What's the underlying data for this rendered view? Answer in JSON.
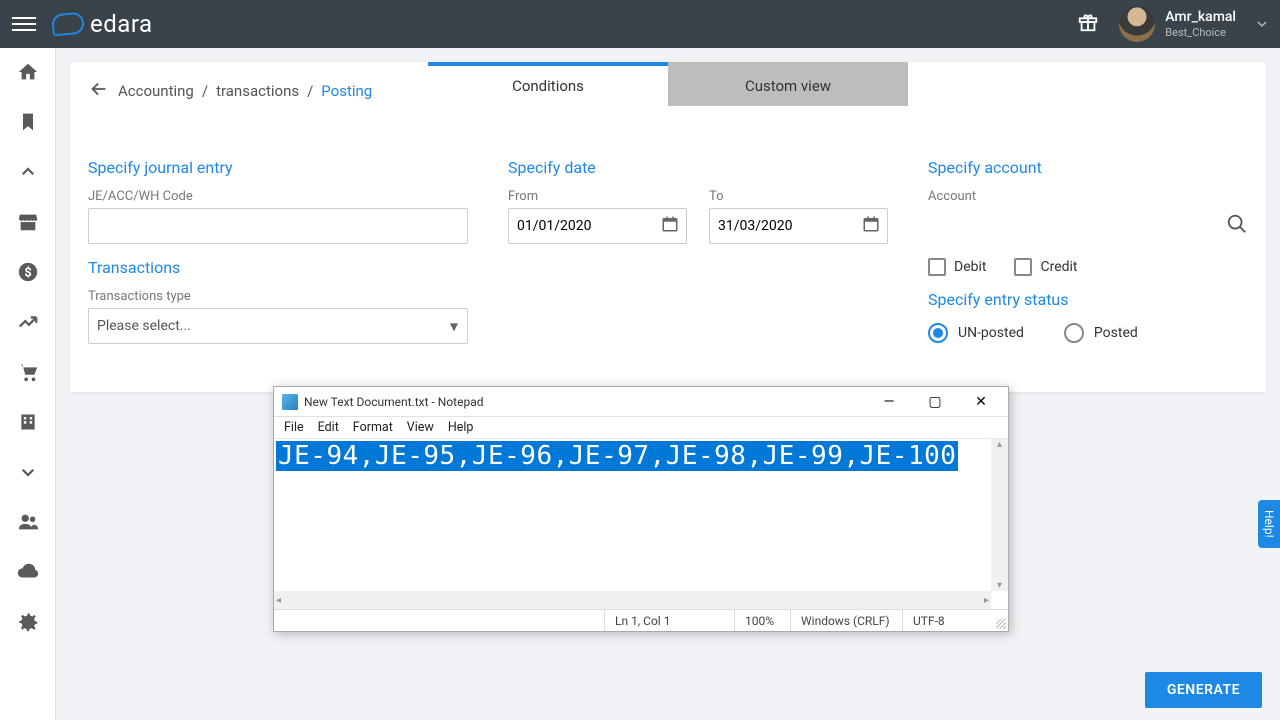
{
  "app": {
    "logo_text": "edara"
  },
  "user": {
    "name": "Amr_kamal",
    "sub": "Best_Choice"
  },
  "breadcrumb": {
    "seg1": "Accounting",
    "seg2": "transactions",
    "seg3": "Posting"
  },
  "tabs": {
    "conditions": "Conditions",
    "custom": "Custom view"
  },
  "journal": {
    "title": "Specify journal entry",
    "label": "JE/ACC/WH Code",
    "value": ""
  },
  "transactions": {
    "title": "Transactions",
    "label": "Transactions type",
    "placeholder": "Please select..."
  },
  "date": {
    "title": "Specify date",
    "from_label": "From",
    "to_label": "To",
    "from": "01/01/2020",
    "to": "31/03/2020"
  },
  "account": {
    "title": "Specify account",
    "label": "Account",
    "debit": "Debit",
    "credit": "Credit"
  },
  "status": {
    "title": "Specify entry status",
    "unposted": "UN-posted",
    "posted": "Posted"
  },
  "buttons": {
    "generate": "GENERATE"
  },
  "help": "Help!",
  "notepad": {
    "title": "New Text Document.txt - Notepad",
    "menu": {
      "file": "File",
      "edit": "Edit",
      "format": "Format",
      "view": "View",
      "help": "Help"
    },
    "text": "JE-94,JE-95,JE-96,JE-97,JE-98,JE-99,JE-100",
    "status": {
      "pos": "Ln 1, Col 1",
      "zoom": "100%",
      "eol": "Windows (CRLF)",
      "enc": "UTF-8"
    }
  }
}
